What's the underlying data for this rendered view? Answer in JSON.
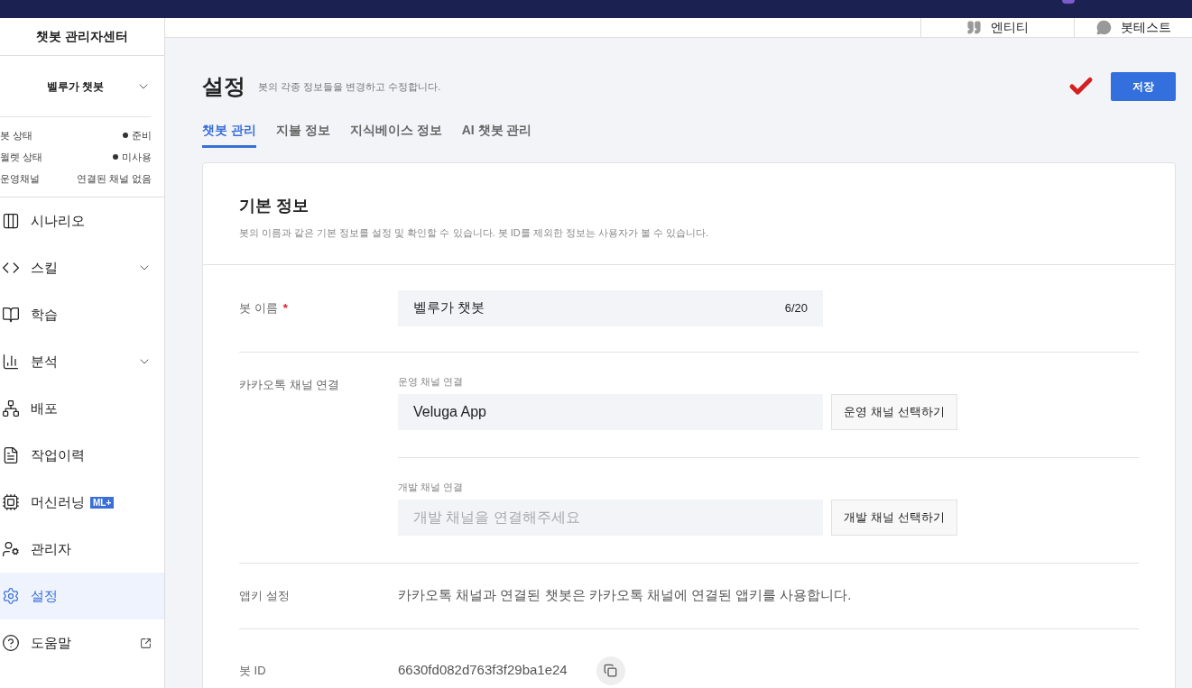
{
  "sidebar": {
    "title": "챗봇 관리자센터",
    "bot_selector": "벨루가 챗봇",
    "status": [
      {
        "label": "봇 상태",
        "value": "준비"
      },
      {
        "label": "월렛 상태",
        "value": "미사용"
      },
      {
        "label": "운영채널",
        "value": "연결된 채널 없음",
        "kind": "plain"
      }
    ],
    "items": [
      {
        "label": "시나리오",
        "kind": "plain",
        "selected": false
      },
      {
        "label": "스킬",
        "kind": "expandable",
        "selected": false
      },
      {
        "label": "학습",
        "kind": "plain",
        "selected": false
      },
      {
        "label": "분석",
        "kind": "expandable",
        "selected": false
      },
      {
        "label": "배포",
        "kind": "plain",
        "selected": false
      },
      {
        "label": "작업이력",
        "kind": "plain",
        "selected": false
      },
      {
        "label": "머신러닝",
        "kind": "badge",
        "badge": "ML+",
        "selected": false
      },
      {
        "label": "관리자",
        "kind": "plain",
        "selected": false
      },
      {
        "label": "설정",
        "kind": "plain",
        "selected": true
      },
      {
        "label": "도움말",
        "kind": "external",
        "selected": false
      }
    ]
  },
  "header_tabs": [
    {
      "label": "엔티티"
    },
    {
      "label": "봇테스트"
    }
  ],
  "page": {
    "title": "설정",
    "subtitle": "봇의 각종 정보들을 변경하고 수정합니다.",
    "save_button": "저장",
    "tabs": [
      {
        "label": "챗봇 관리",
        "selected": true
      },
      {
        "label": "지불 정보",
        "selected": false
      },
      {
        "label": "지식베이스 정보",
        "selected": false
      },
      {
        "label": "AI 챗봇 관리",
        "selected": false
      }
    ]
  },
  "card": {
    "title": "기본 정보",
    "description": "봇의 이름과 같은 기본 정보를 설정 및 확인할 수 있습니다. 봇 ID를 제외한 정보는 사용자가 볼 수 있습니다.",
    "bot_name": {
      "label": "봇 이름",
      "required_mark": "*",
      "value": "벨루가 챗봇",
      "counter": "6/20"
    },
    "kakao": {
      "label": "카카오톡 채널 연결",
      "channels": [
        {
          "label": "운영 채널 연결",
          "value": "Veluga App",
          "button": "운영 채널 선택하기"
        },
        {
          "label": "개발 채널 연결",
          "placeholder": "개발 채널을 연결해주세요",
          "button": "개발 채널 선택하기"
        }
      ]
    },
    "app_key": {
      "label": "앱키 설정",
      "text": "카카오톡 채널과 연결된 챗봇은 카카오톡 채널에 연결된 앱키를 사용합니다."
    },
    "bot_id": {
      "label": "봇 ID",
      "value": "6630fd082d763f3f29ba1e24"
    }
  }
}
